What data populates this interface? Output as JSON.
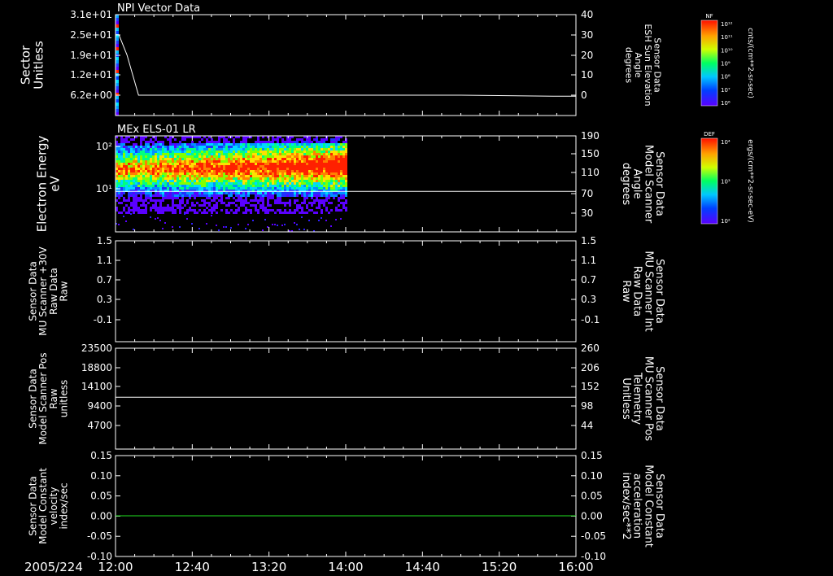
{
  "date_label": "2005/224",
  "time_ticks": [
    "12:00",
    "12:40",
    "13:20",
    "14:00",
    "14:40",
    "15:20",
    "16:00"
  ],
  "colorbars": [
    {
      "label": "NF",
      "ticks": [
        "10¹²",
        "10¹¹",
        "10¹⁰",
        "10⁹",
        "10⁸",
        "10⁷",
        "10⁶"
      ],
      "units": "cnts/(cm**2-sr-sec)"
    },
    {
      "label": "DEF",
      "ticks": [
        "10⁴",
        "10³",
        "10²"
      ],
      "units": "ergs/(cm**2-sr-sec-eV)"
    }
  ],
  "chart_data": [
    {
      "type": "spectrogram",
      "title": "NPI Vector Data",
      "left_axis": {
        "label": [
          "Sector",
          "Unitless"
        ],
        "ticks": [
          "3.1e+01",
          "2.5e+01",
          "1.9e+01",
          "1.2e+01",
          "6.2e+00"
        ]
      },
      "right_axis": {
        "label": [
          "Sensor Data",
          "ESH Sun Elevation",
          "Angle",
          "degrees"
        ],
        "ticks": [
          "40",
          "30",
          "20",
          "10",
          "0"
        ],
        "ylim": [
          -8,
          40
        ]
      },
      "line": {
        "color": "#ffffff",
        "x_hours": [
          12.0,
          12.03,
          12.1,
          12.2,
          12.35,
          13.0,
          14.0,
          15.0,
          15.8,
          16.0
        ],
        "y": [
          30,
          30,
          20,
          0,
          0,
          0,
          0,
          0,
          -0.5,
          -0.5
        ]
      }
    },
    {
      "type": "spectrogram",
      "title": "MEx ELS-01 LR",
      "left_axis": {
        "label": [
          "Electron Energy",
          "eV"
        ],
        "ticks": [
          "10²",
          "10¹"
        ]
      },
      "right_axis": {
        "label": [
          "Sensor Data",
          "Model Scanner",
          "Angle",
          "degrees"
        ],
        "ticks": [
          "190",
          "150",
          "110",
          "70",
          "30"
        ],
        "ylim": [
          10,
          190
        ]
      },
      "spectrogram_extent_hours": [
        12.0,
        14.0
      ],
      "line": {
        "color": "#ffffff",
        "x_hours": [
          12.0,
          16.0
        ],
        "y": [
          86,
          86
        ]
      }
    },
    {
      "type": "line",
      "title": "",
      "left_axis": {
        "label": [
          "Sensor Data",
          "MU Scanner +30V",
          "Raw Data",
          "Raw"
        ],
        "ticks": [
          "1.5",
          "1.1",
          "0.7",
          "0.3",
          "-0.1"
        ]
      },
      "right_axis": {
        "label": [
          "Sensor Data",
          "MU Scanner Int",
          "Raw Data",
          "Raw"
        ],
        "ticks": [
          "1.5",
          "1.1",
          "0.7",
          "0.3",
          "-0.1"
        ],
        "color": "#ff2020"
      }
    },
    {
      "type": "line",
      "title": "",
      "left_axis": {
        "label": [
          "Sensor Data",
          "Model Scanner Pos",
          "Raw",
          "unitless"
        ],
        "ticks": [
          "23500",
          "18800",
          "14100",
          "9400",
          "4700"
        ]
      },
      "right_axis": {
        "label": [
          "Sensor Data",
          "MU Scanner Pos",
          "Telemetry",
          "Unitless"
        ],
        "ticks": [
          "260",
          "206",
          "152",
          "98",
          "44"
        ],
        "color": "#ff2020"
      },
      "line": {
        "color": "#ffffff",
        "x_hours": [
          12.0,
          16.0
        ],
        "y": [
          11500,
          11500
        ]
      }
    },
    {
      "type": "line",
      "title": "",
      "left_axis": {
        "label": [
          "Sensor Data",
          "Model Constant",
          "velocity",
          "index/sec"
        ],
        "ticks": [
          "0.15",
          "0.10",
          "0.05",
          "0.00",
          "-0.05",
          "-0.10"
        ]
      },
      "right_axis": {
        "label": [
          "Sensor Data",
          "Model Constant",
          "acceleration",
          "index/sec**2"
        ],
        "ticks": [
          "0.15",
          "0.10",
          "0.05",
          "0.00",
          "-0.05",
          "-0.10"
        ],
        "color": "#20e020"
      },
      "line": {
        "color": "#20e020",
        "x_hours": [
          12.0,
          16.0
        ],
        "y": [
          0,
          0
        ]
      }
    }
  ]
}
